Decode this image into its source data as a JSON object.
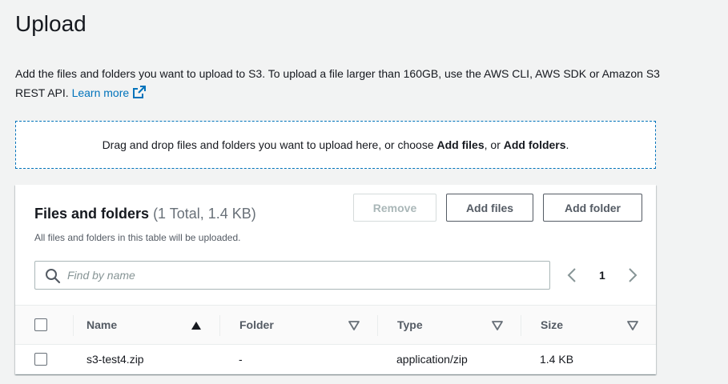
{
  "page": {
    "title": "Upload",
    "description": "Add the files and folders you want to upload to S3. To upload a file larger than 160GB, use the AWS CLI, AWS SDK or Amazon S3 REST API.",
    "learn_more": "Learn more"
  },
  "dropzone": {
    "text_prefix": "Drag and drop files and folders you want to upload here, or choose ",
    "add_files": "Add files",
    "text_middle": ", or ",
    "add_folders": "Add folders",
    "text_suffix": "."
  },
  "panel": {
    "title": "Files and folders",
    "count": "(1 Total, 1.4 KB)",
    "subtitle": "All files and folders in this table will be uploaded.",
    "buttons": {
      "remove": "Remove",
      "add_files": "Add files",
      "add_folder": "Add folder"
    },
    "search": {
      "placeholder": "Find by name",
      "value": ""
    },
    "pagination": {
      "current_page": "1"
    }
  },
  "table": {
    "columns": [
      "Name",
      "Folder",
      "Type",
      "Size"
    ],
    "rows": [
      {
        "name": "s3-test4.zip",
        "folder": "-",
        "type": "application/zip",
        "size": "1.4 KB"
      }
    ]
  },
  "colors": {
    "link": "#0073bb",
    "dropzone_border": "#0073bb",
    "button_border": "#545b64",
    "disabled": "#aab7b8",
    "background": "#f2f3f3"
  },
  "icons": {
    "external_link": "external-link-icon",
    "search": "search-icon",
    "prev": "chevron-left-icon",
    "next": "chevron-right-icon",
    "sort_asc": "sort-ascending-icon",
    "sort_none": "sort-caret-down-icon"
  }
}
